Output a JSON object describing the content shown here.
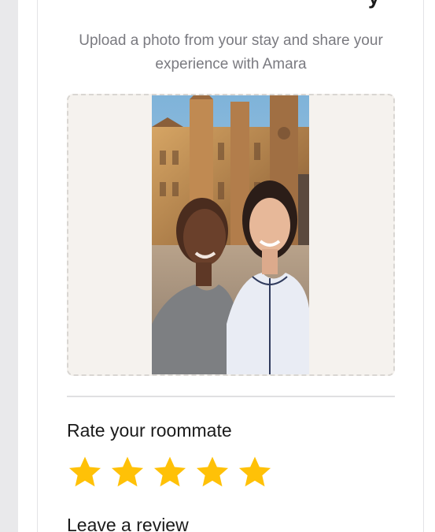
{
  "form": {
    "title_visible_fragment": "y",
    "subtitle": "Upload a photo from your stay and share your experience with Amara"
  },
  "photo_upload": {
    "has_photo": true
  },
  "rating": {
    "heading": "Rate your roommate",
    "value": 5,
    "max": 5,
    "star_color": "#ffc107"
  },
  "review": {
    "heading": "Leave a review"
  }
}
